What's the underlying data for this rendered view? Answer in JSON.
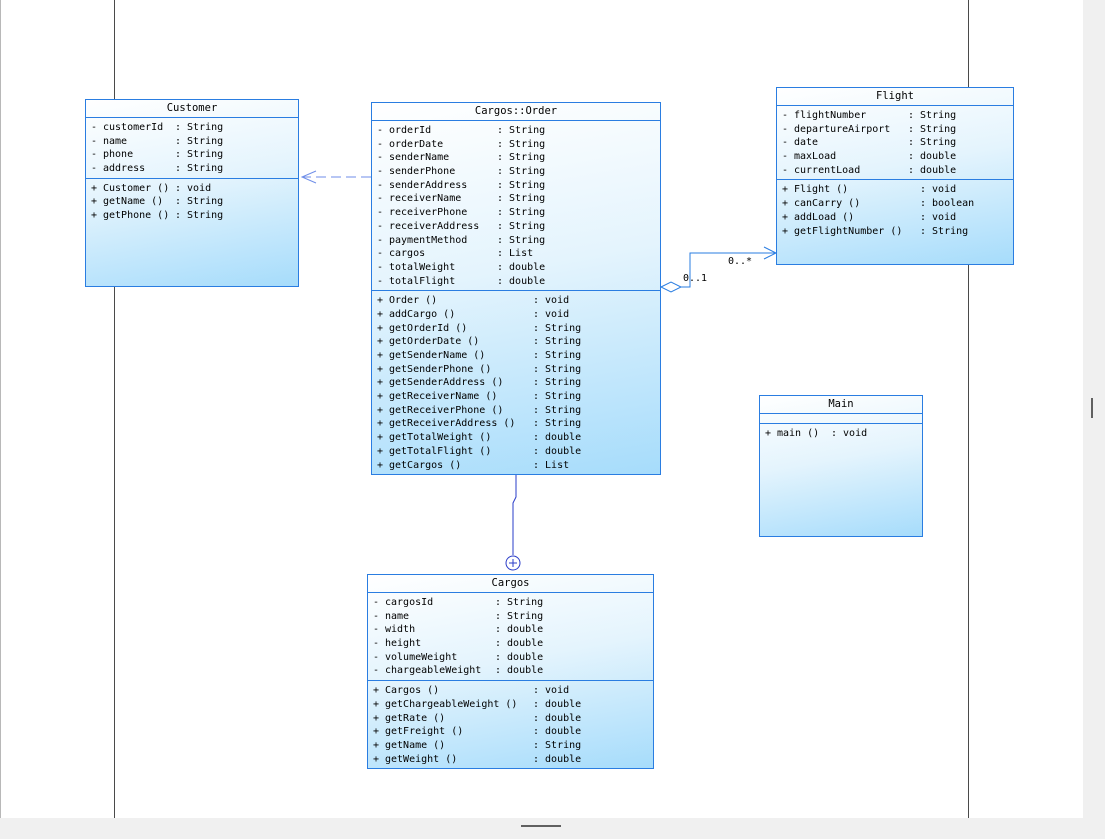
{
  "classes": {
    "customer": {
      "title": "Customer",
      "attributes": [
        {
          "vis": "-",
          "name": "customerId",
          "type": ": String"
        },
        {
          "vis": "-",
          "name": "name",
          "type": ": String"
        },
        {
          "vis": "-",
          "name": "phone",
          "type": ": String"
        },
        {
          "vis": "-",
          "name": "address",
          "type": ": String"
        }
      ],
      "operations": [
        {
          "vis": "+",
          "name": "Customer ()",
          "type": ": void"
        },
        {
          "vis": "+",
          "name": "getName ()",
          "type": ": String"
        },
        {
          "vis": "+",
          "name": "getPhone ()",
          "type": ": String"
        }
      ]
    },
    "order": {
      "title": "Cargos::Order",
      "attributes": [
        {
          "vis": "-",
          "name": "orderId",
          "type": ": String"
        },
        {
          "vis": "-",
          "name": "orderDate",
          "type": ": String"
        },
        {
          "vis": "-",
          "name": "senderName",
          "type": ": String"
        },
        {
          "vis": "-",
          "name": "senderPhone",
          "type": ": String"
        },
        {
          "vis": "-",
          "name": "senderAddress",
          "type": ": String"
        },
        {
          "vis": "-",
          "name": "receiverName",
          "type": ": String"
        },
        {
          "vis": "-",
          "name": "receiverPhone",
          "type": ": String"
        },
        {
          "vis": "-",
          "name": "receiverAddress",
          "type": ": String"
        },
        {
          "vis": "-",
          "name": "paymentMethod",
          "type": ": String"
        },
        {
          "vis": "-",
          "name": "cargos",
          "type": ": List"
        },
        {
          "vis": "-",
          "name": "totalWeight",
          "type": ": double"
        },
        {
          "vis": "-",
          "name": "totalFlight",
          "type": ": double"
        }
      ],
      "operations": [
        {
          "vis": "+",
          "name": "Order ()",
          "type": ": void"
        },
        {
          "vis": "+",
          "name": "addCargo ()",
          "type": ": void"
        },
        {
          "vis": "+",
          "name": "getOrderId ()",
          "type": ": String"
        },
        {
          "vis": "+",
          "name": "getOrderDate ()",
          "type": ": String"
        },
        {
          "vis": "+",
          "name": "getSenderName ()",
          "type": ": String"
        },
        {
          "vis": "+",
          "name": "getSenderPhone ()",
          "type": ": String"
        },
        {
          "vis": "+",
          "name": "getSenderAddress ()",
          "type": ": String"
        },
        {
          "vis": "+",
          "name": "getReceiverName ()",
          "type": ": String"
        },
        {
          "vis": "+",
          "name": "getReceiverPhone ()",
          "type": ": String"
        },
        {
          "vis": "+",
          "name": "getReceiverAddress ()",
          "type": ": String"
        },
        {
          "vis": "+",
          "name": "getTotalWeight ()",
          "type": ": double"
        },
        {
          "vis": "+",
          "name": "getTotalFlight ()",
          "type": ": double"
        },
        {
          "vis": "+",
          "name": "getCargos ()",
          "type": ": List"
        }
      ]
    },
    "flight": {
      "title": "Flight",
      "attributes": [
        {
          "vis": "-",
          "name": "flightNumber",
          "type": ": String"
        },
        {
          "vis": "-",
          "name": "departureAirport",
          "type": ": String"
        },
        {
          "vis": "-",
          "name": "date",
          "type": ": String"
        },
        {
          "vis": "-",
          "name": "maxLoad",
          "type": ": double"
        },
        {
          "vis": "-",
          "name": "currentLoad",
          "type": ": double"
        }
      ],
      "operations": [
        {
          "vis": "+",
          "name": "Flight ()",
          "type": ": void"
        },
        {
          "vis": "+",
          "name": "canCarry ()",
          "type": ": boolean"
        },
        {
          "vis": "+",
          "name": "addLoad ()",
          "type": ": void"
        },
        {
          "vis": "+",
          "name": "getFlightNumber ()",
          "type": ": String"
        }
      ]
    },
    "main": {
      "title": "Main",
      "attributes": [],
      "operations": [
        {
          "vis": "+",
          "name": "main ()",
          "type": ": void"
        }
      ]
    },
    "cargos": {
      "title": "Cargos",
      "attributes": [
        {
          "vis": "-",
          "name": "cargosId",
          "type": ": String"
        },
        {
          "vis": "-",
          "name": "name",
          "type": ": String"
        },
        {
          "vis": "-",
          "name": "width",
          "type": ": double"
        },
        {
          "vis": "-",
          "name": "height",
          "type": ": double"
        },
        {
          "vis": "-",
          "name": "volumeWeight",
          "type": ": double"
        },
        {
          "vis": "-",
          "name": "chargeableWeight",
          "type": ": double"
        }
      ],
      "operations": [
        {
          "vis": "+",
          "name": "Cargos ()",
          "type": ": void"
        },
        {
          "vis": "+",
          "name": "getChargeableWeight ()",
          "type": ": double"
        },
        {
          "vis": "+",
          "name": "getRate ()",
          "type": ": double"
        },
        {
          "vis": "+",
          "name": "getFreight ()",
          "type": ": double"
        },
        {
          "vis": "+",
          "name": "getName ()",
          "type": ": String"
        },
        {
          "vis": "+",
          "name": "getWeight ()",
          "type": ": double"
        }
      ]
    }
  },
  "relations": {
    "order_flight": {
      "source_mult": "0..1",
      "target_mult": "0..*"
    }
  },
  "colors": {
    "border": "#2a7de1",
    "line": "#4a5fd8",
    "gradient_light": "#ffffff",
    "gradient_dark": "#a6dcfb"
  }
}
